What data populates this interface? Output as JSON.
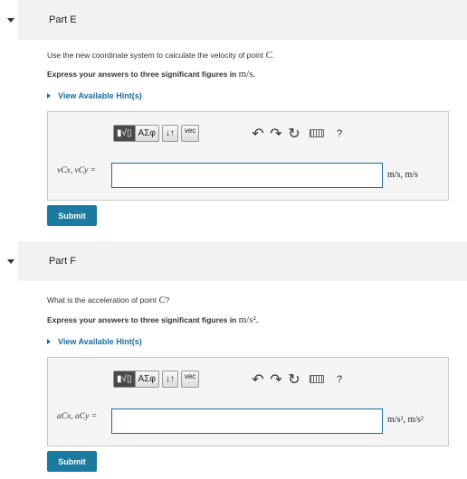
{
  "parts": [
    {
      "title": "Part E",
      "question_prefix": "Use the new coordinate system to calculate the velocity of point ",
      "question_var": "C",
      "question_suffix": ".",
      "instruction_prefix": "Express your answers to three significant figures in ",
      "instruction_unit": "m/s",
      "instruction_suffix": ".",
      "hints": "View Available Hint(s)",
      "input_label": "vCx, vCy =",
      "input_value": "",
      "unit": "m/s, m/s",
      "submit": "Submit"
    },
    {
      "title": "Part F",
      "question_prefix": "What is the acceleration of point ",
      "question_var": "C",
      "question_suffix": "?",
      "instruction_prefix": "Express your answers to three significant figures in ",
      "instruction_unit": "m/s²",
      "instruction_suffix": ".",
      "hints": "View Available Hint(s)",
      "input_label": "aCx, aCy =",
      "input_value": "",
      "unit": "m/s², m/s²",
      "submit": "Submit"
    }
  ],
  "toolbar": {
    "templates": "▮√▯",
    "greek": "ΑΣφ",
    "arrows": "↓↑",
    "vec": "vec",
    "undo": "↶",
    "redo": "↷",
    "reset": "↻",
    "help": "?"
  },
  "icons": [
    "caret-down-icon",
    "chevron-right-icon",
    "undo-icon",
    "redo-icon",
    "reset-icon",
    "keyboard-icon",
    "help-icon"
  ]
}
